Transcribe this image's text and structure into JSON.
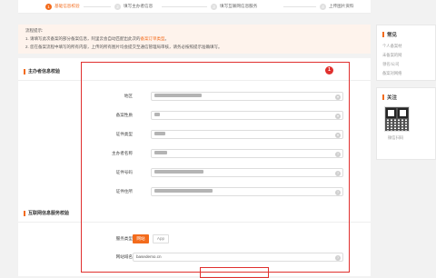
{
  "steps": [
    {
      "num": "1",
      "label": "基础信息校验",
      "active": true
    },
    {
      "num": "2",
      "label": "填写主办者信息",
      "active": false
    },
    {
      "num": "3",
      "label": "填写互联网信息服务",
      "active": false
    },
    {
      "num": "4",
      "label": "上传图片资料",
      "active": false
    }
  ],
  "notice": {
    "title": "流程提示:",
    "line1": "1. 请填写此次备案的部分备案信息，阿里云会自动匹配出此次的",
    "line1_link": "备案订单类型",
    "line1_end": "。",
    "line2": "2. 您在备案流程中填写的所有内容，上传的所有图片均会提交至通信管理局审核，请务必按照提示准确填写。"
  },
  "form": {
    "section_sponsor": "主办者信息校验",
    "badge": "1",
    "fields": [
      {
        "label": "地区",
        "value": "",
        "icon": "chevron-down-icon"
      },
      {
        "label": "备案性质",
        "value": "",
        "icon": "chevron-down-icon"
      },
      {
        "label": "证件类型",
        "value": "",
        "icon": "chevron-down-icon"
      },
      {
        "label": "主办者名称",
        "value": "",
        "icon": "help-icon"
      },
      {
        "label": "证件号码",
        "value": "",
        "icon": "help-icon"
      },
      {
        "label": "证件住所",
        "value": "",
        "icon": "help-icon"
      }
    ],
    "section_service": "互联网信息服务校验",
    "service_type_label": "服务类型",
    "service_types": [
      "网站",
      "App"
    ],
    "domain_label": "网站域名",
    "domain_value": "basedemo.cn"
  },
  "sidebar": {
    "faq_title": "常见",
    "faq_links": [
      "个人备案材",
      "未备案的网",
      "领名/公司",
      "备案对网络"
    ],
    "follow_title": "关注",
    "qr_caption": "微信扫码"
  },
  "colors": {
    "accent": "#f36b1c",
    "highlight": "#e0302e"
  }
}
